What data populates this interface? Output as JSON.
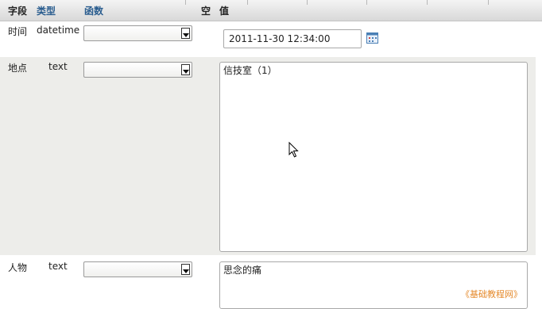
{
  "header": {
    "field": "字段",
    "type": "类型",
    "function": "函数",
    "null": "空",
    "value": "值"
  },
  "rows": [
    {
      "field": "时间",
      "type": "datetime",
      "function_selected": "",
      "value": "2011-11-30 12:34:00"
    },
    {
      "field": "地点",
      "type": "text",
      "function_selected": "",
      "value": "信技室（1）"
    },
    {
      "field": "人物",
      "type": "text",
      "function_selected": "",
      "value": "思念的痛"
    }
  ],
  "icons": {
    "calendar": "calendar-icon",
    "cursor": "mouse-pointer-icon",
    "select_arrow": "chevron-down-icon"
  },
  "watermark": "《基础教程网》",
  "colors": {
    "header_link": "#2a5d8f",
    "row_alt": "#ededea",
    "watermark": "#e58a2c"
  }
}
